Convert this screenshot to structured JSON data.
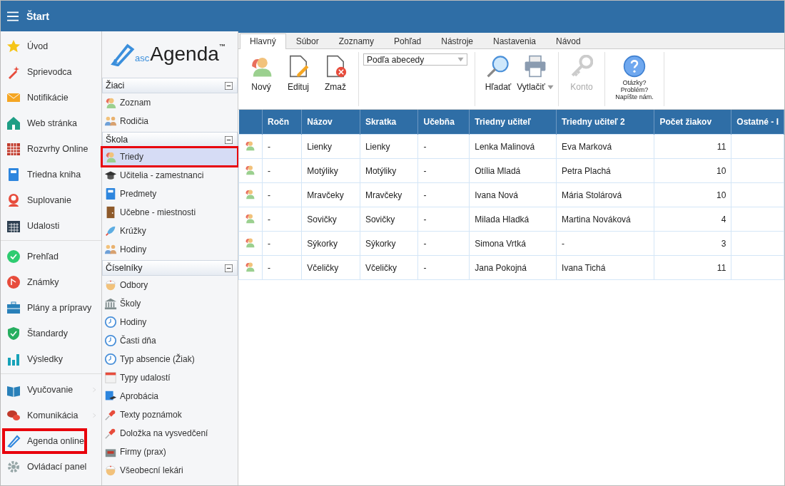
{
  "header": {
    "title": "Štart"
  },
  "nav": {
    "groups": [
      {
        "items": [
          {
            "label": "Úvod",
            "highlighted": false,
            "submenu": false
          },
          {
            "label": "Sprievodca",
            "highlighted": false,
            "submenu": false
          },
          {
            "label": "Notifikácie",
            "highlighted": false,
            "submenu": false
          },
          {
            "label": "Web stránka",
            "highlighted": false,
            "submenu": false
          },
          {
            "label": "Rozvrhy Online",
            "highlighted": false,
            "submenu": false
          },
          {
            "label": "Triedna kniha",
            "highlighted": false,
            "submenu": false
          },
          {
            "label": "Suplovanie",
            "highlighted": false,
            "submenu": false
          },
          {
            "label": "Udalosti",
            "highlighted": false,
            "submenu": false
          }
        ]
      },
      {
        "items": [
          {
            "label": "Prehľad",
            "highlighted": false,
            "submenu": false
          },
          {
            "label": "Známky",
            "highlighted": false,
            "submenu": false
          },
          {
            "label": "Plány a prípravy",
            "highlighted": false,
            "submenu": false
          },
          {
            "label": "Štandardy",
            "highlighted": false,
            "submenu": false
          },
          {
            "label": "Výsledky",
            "highlighted": false,
            "submenu": false
          }
        ]
      },
      {
        "items": [
          {
            "label": "Vyučovanie",
            "highlighted": false,
            "submenu": true
          },
          {
            "label": "Komunikácia",
            "highlighted": false,
            "submenu": true
          },
          {
            "label": "Agenda online",
            "highlighted": true,
            "submenu": false
          },
          {
            "label": "Ovládací panel",
            "highlighted": false,
            "submenu": false
          }
        ]
      }
    ]
  },
  "logo": {
    "prefix": "asc",
    "name": "Agenda",
    "mark": "™"
  },
  "sections": [
    {
      "title": "Žiaci",
      "expanded": true,
      "items": [
        {
          "label": "Zoznam",
          "selected": false,
          "highlighted": false
        },
        {
          "label": "Rodičia",
          "selected": false,
          "highlighted": false
        }
      ]
    },
    {
      "title": "Škola",
      "expanded": true,
      "items": [
        {
          "label": "Triedy",
          "selected": true,
          "highlighted": true
        },
        {
          "label": "Učitelia - zamestnanci",
          "selected": false,
          "highlighted": false
        },
        {
          "label": "Predmety",
          "selected": false,
          "highlighted": false
        },
        {
          "label": "Učebne - miestnosti",
          "selected": false,
          "highlighted": false
        },
        {
          "label": "Krúžky",
          "selected": false,
          "highlighted": false
        },
        {
          "label": "Hodiny",
          "selected": false,
          "highlighted": false
        }
      ]
    },
    {
      "title": "Číselníky",
      "expanded": true,
      "items": [
        {
          "label": "Odbory",
          "selected": false,
          "highlighted": false
        },
        {
          "label": "Školy",
          "selected": false,
          "highlighted": false
        },
        {
          "label": "Hodiny",
          "selected": false,
          "highlighted": false
        },
        {
          "label": "Časti dňa",
          "selected": false,
          "highlighted": false
        },
        {
          "label": "Typ absencie (Žiak)",
          "selected": false,
          "highlighted": false
        },
        {
          "label": "Typy udalostí",
          "selected": false,
          "highlighted": false
        },
        {
          "label": "Aprobácia",
          "selected": false,
          "highlighted": false
        },
        {
          "label": "Texty poznámok",
          "selected": false,
          "highlighted": false
        },
        {
          "label": "Doložka na vysvedčení",
          "selected": false,
          "highlighted": false
        },
        {
          "label": "Firmy (prax)",
          "selected": false,
          "highlighted": false
        },
        {
          "label": "Všeobecní lekári",
          "selected": false,
          "highlighted": false
        }
      ]
    }
  ],
  "ribbon": {
    "tabs": [
      {
        "label": "Hlavný",
        "selected": true
      },
      {
        "label": "Súbor",
        "selected": false
      },
      {
        "label": "Zoznamy",
        "selected": false
      },
      {
        "label": "Pohľad",
        "selected": false
      },
      {
        "label": "Nástroje",
        "selected": false
      },
      {
        "label": "Nastavenia",
        "selected": false
      },
      {
        "label": "Návod",
        "selected": false
      }
    ],
    "groups": [
      {
        "kind": "buttons",
        "buttons": [
          {
            "label": "Nový",
            "disabled": false,
            "dropdown": false
          },
          {
            "label": "Edituj",
            "disabled": false,
            "dropdown": false
          },
          {
            "label": "Zmaž",
            "disabled": false,
            "dropdown": false
          }
        ]
      },
      {
        "kind": "select",
        "value": "Podľa abecedy"
      },
      {
        "kind": "buttons",
        "buttons": [
          {
            "label": "Hľadať",
            "disabled": false,
            "dropdown": false
          },
          {
            "label": "Vytlačiť",
            "disabled": false,
            "dropdown": true
          }
        ]
      },
      {
        "kind": "buttons",
        "buttons": [
          {
            "label": "Konto",
            "disabled": true,
            "dropdown": false
          }
        ]
      },
      {
        "kind": "help",
        "lines": [
          "Otázky?",
          "Problém?",
          "Napíšte nám."
        ]
      }
    ]
  },
  "table": {
    "columns": [
      "Ročn",
      "Názov",
      "Skratka",
      "Učebňa",
      "Triedny učiteľ",
      "Triedny učiteľ 2",
      "Počet žiakov",
      "Ostatné - I"
    ],
    "rows": [
      [
        "-",
        "Lienky",
        "Lienky",
        "-",
        "Lenka Malinová",
        "Eva Marková",
        "11",
        ""
      ],
      [
        "-",
        "Motýliky",
        "Motýliky",
        "-",
        "Otília Mladá",
        "Petra Plachá",
        "10",
        ""
      ],
      [
        "-",
        "Mravčeky",
        "Mravčeky",
        "-",
        "Ivana Nová",
        "Mária Stolárová",
        "10",
        ""
      ],
      [
        "-",
        "Sovičky",
        "Sovičky",
        "-",
        "Milada Hladká",
        "Martina Nováková",
        "4",
        ""
      ],
      [
        "-",
        "Sýkorky",
        "Sýkorky",
        "-",
        "Simona Vrtká",
        "-",
        "3",
        ""
      ],
      [
        "-",
        "Včeličky",
        "Včeličky",
        "-",
        "Jana Pokojná",
        "Ivana Tichá",
        "11",
        ""
      ]
    ]
  }
}
